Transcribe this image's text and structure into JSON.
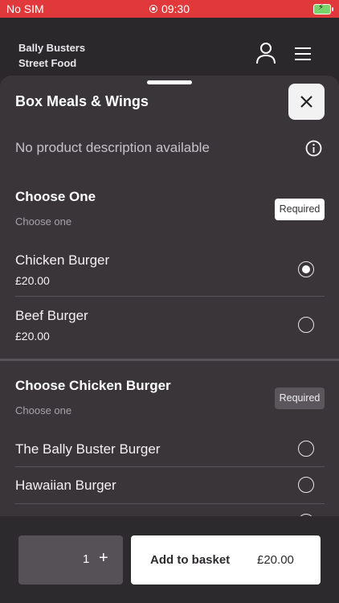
{
  "status_bar": {
    "carrier": "No SIM",
    "time": "09:30"
  },
  "header": {
    "brand_line1": "Bally Busters",
    "brand_line2": "Street Food"
  },
  "product": {
    "title": "Box Meals & Wings",
    "description": "No product description available"
  },
  "groups": [
    {
      "title": "Choose One",
      "subtitle": "Choose one",
      "badge": "Required",
      "options": [
        {
          "name": "Chicken Burger",
          "price": "£20.00",
          "selected": true
        },
        {
          "name": "Beef Burger",
          "price": "£20.00",
          "selected": false
        }
      ]
    },
    {
      "title": "Choose Chicken Burger",
      "subtitle": "Choose one",
      "badge": "Required",
      "options": [
        {
          "name": "The Bally Buster Burger",
          "selected": false
        },
        {
          "name": "Hawaiian Burger",
          "selected": false
        }
      ]
    }
  ],
  "footer": {
    "quantity": "1",
    "plus": "+",
    "add_label": "Add to basket",
    "add_price": "£20.00"
  },
  "colors": {
    "status_bar": "#e0383b",
    "background": "#2d2a2e",
    "sheet": "#393539"
  }
}
